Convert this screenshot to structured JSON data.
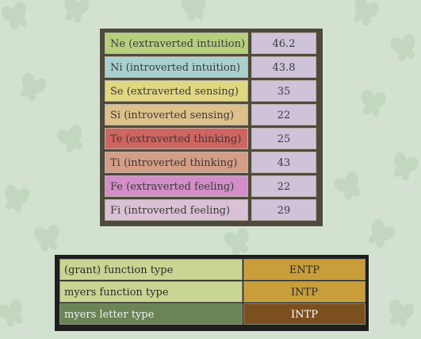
{
  "functions": [
    {
      "name": "Ne (extraverted intuition)",
      "value": "46.2",
      "color": "#b6cf7e"
    },
    {
      "name": "Ni (introverted intuition)",
      "value": "43.8",
      "color": "#a9d0cf"
    },
    {
      "name": "Se (extraverted sensing)",
      "value": "35",
      "color": "#e1d782"
    },
    {
      "name": "Si (introverted sensing)",
      "value": "22",
      "color": "#dcc18b"
    },
    {
      "name": "Te (extraverted thinking)",
      "value": "25",
      "color": "#cf6561"
    },
    {
      "name": "Ti (introverted thinking)",
      "value": "43",
      "color": "#d49e86"
    },
    {
      "name": "Fe (extraverted feeling)",
      "value": "22",
      "color": "#d38ec9"
    },
    {
      "name": "Fi (introverted feeling)",
      "value": "29",
      "color": "#dac1d6"
    }
  ],
  "types": [
    {
      "label": "(grant) function type",
      "value": "ENTP",
      "label_color": "#c9d592",
      "value_color": "#c89d3a",
      "label_text_color": "#2a2a2a",
      "value_text_color": "#2a2a2a"
    },
    {
      "label": "myers function type",
      "value": "INTP",
      "label_color": "#c9d592",
      "value_color": "#c89d3a",
      "label_text_color": "#2a2a2a",
      "value_text_color": "#2a2a2a"
    },
    {
      "label": "myers letter type",
      "value": "INTP",
      "label_color": "#6b8456",
      "value_color": "#7c4f1e",
      "label_text_color": "#f0f0f0",
      "value_text_color": "#ffffff"
    }
  ],
  "colors": {
    "page_background": "#d3e2d0",
    "butterfly_pattern": "#c2d5bf",
    "value_cell": "#cec3d9"
  }
}
